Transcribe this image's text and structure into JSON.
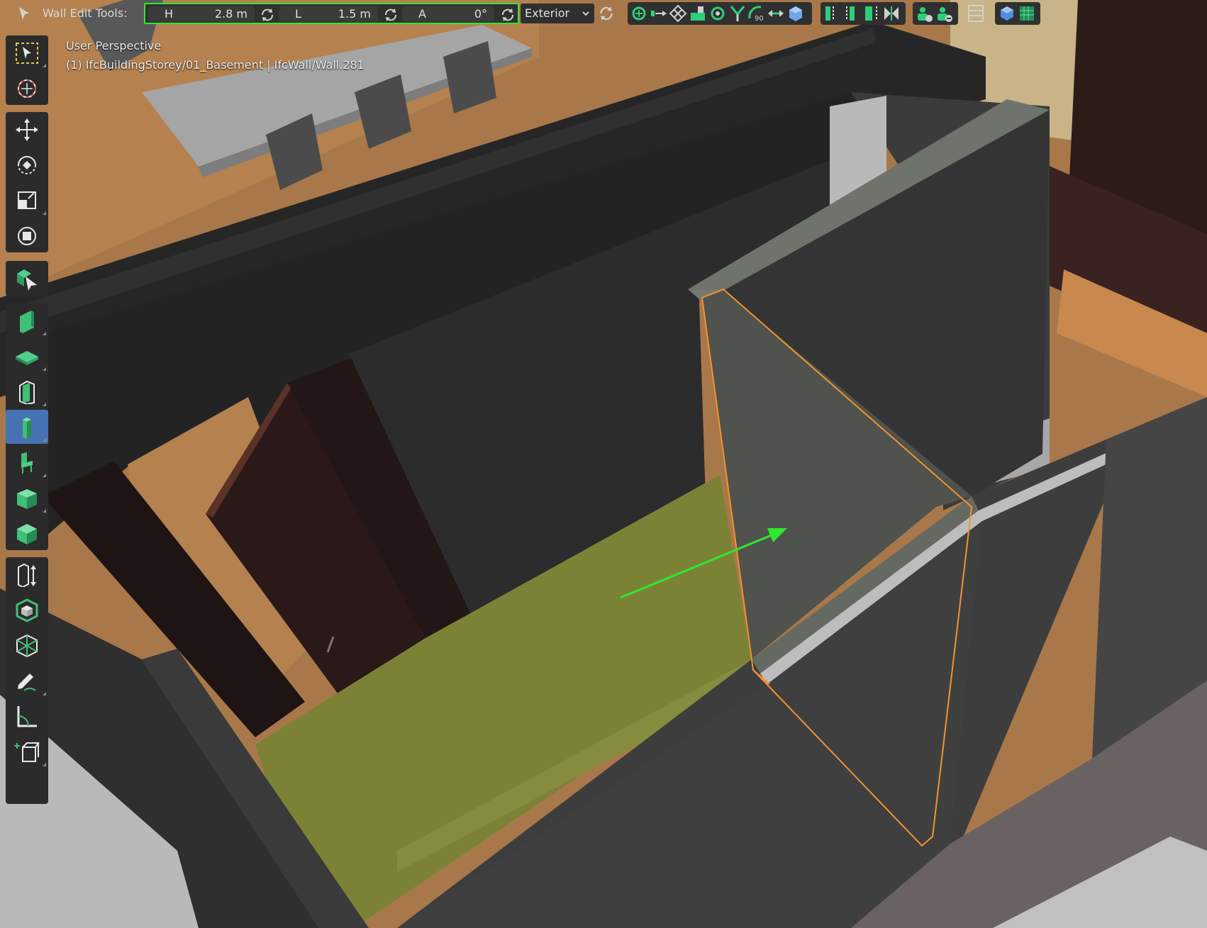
{
  "toolbar_header": {
    "title": "Wall Edit Tools:",
    "fields": [
      {
        "label": "H",
        "value": "2.8 m"
      },
      {
        "label": "L",
        "value": "1.5 m"
      },
      {
        "label": "A",
        "value": "0°"
      }
    ],
    "location_select": "Exterior",
    "icon_names": [
      "refresh-icon",
      "join-icon",
      "extend-icon",
      "merge-icon",
      "flip-icon",
      "rotate-icon",
      "split-icon",
      "angle-90-icon",
      "mitre-icon",
      "array-icon",
      "layers-icon"
    ]
  },
  "viewport": {
    "view_name": "User Perspective",
    "selection_path": "(1) IfcBuildingStorey/01_Basement | IfcWall/Wall.281"
  },
  "left_toolbar": {
    "tools": [
      "select-box",
      "cursor",
      "move",
      "rotate",
      "scale",
      "transform",
      "explore",
      "wall",
      "slab",
      "door",
      "column",
      "furniture",
      "roof",
      "covering",
      "extrude-profile",
      "cube",
      "mesh",
      "annotate",
      "measure",
      "add-cube"
    ],
    "active_tool": "column"
  },
  "colors": {
    "accent_green": "#2ee82e",
    "selection_orange": "#f29230",
    "active_tool_blue": "#4772b3",
    "floor_yellow": "#7b8236",
    "floor_wood": "#b4814f"
  }
}
